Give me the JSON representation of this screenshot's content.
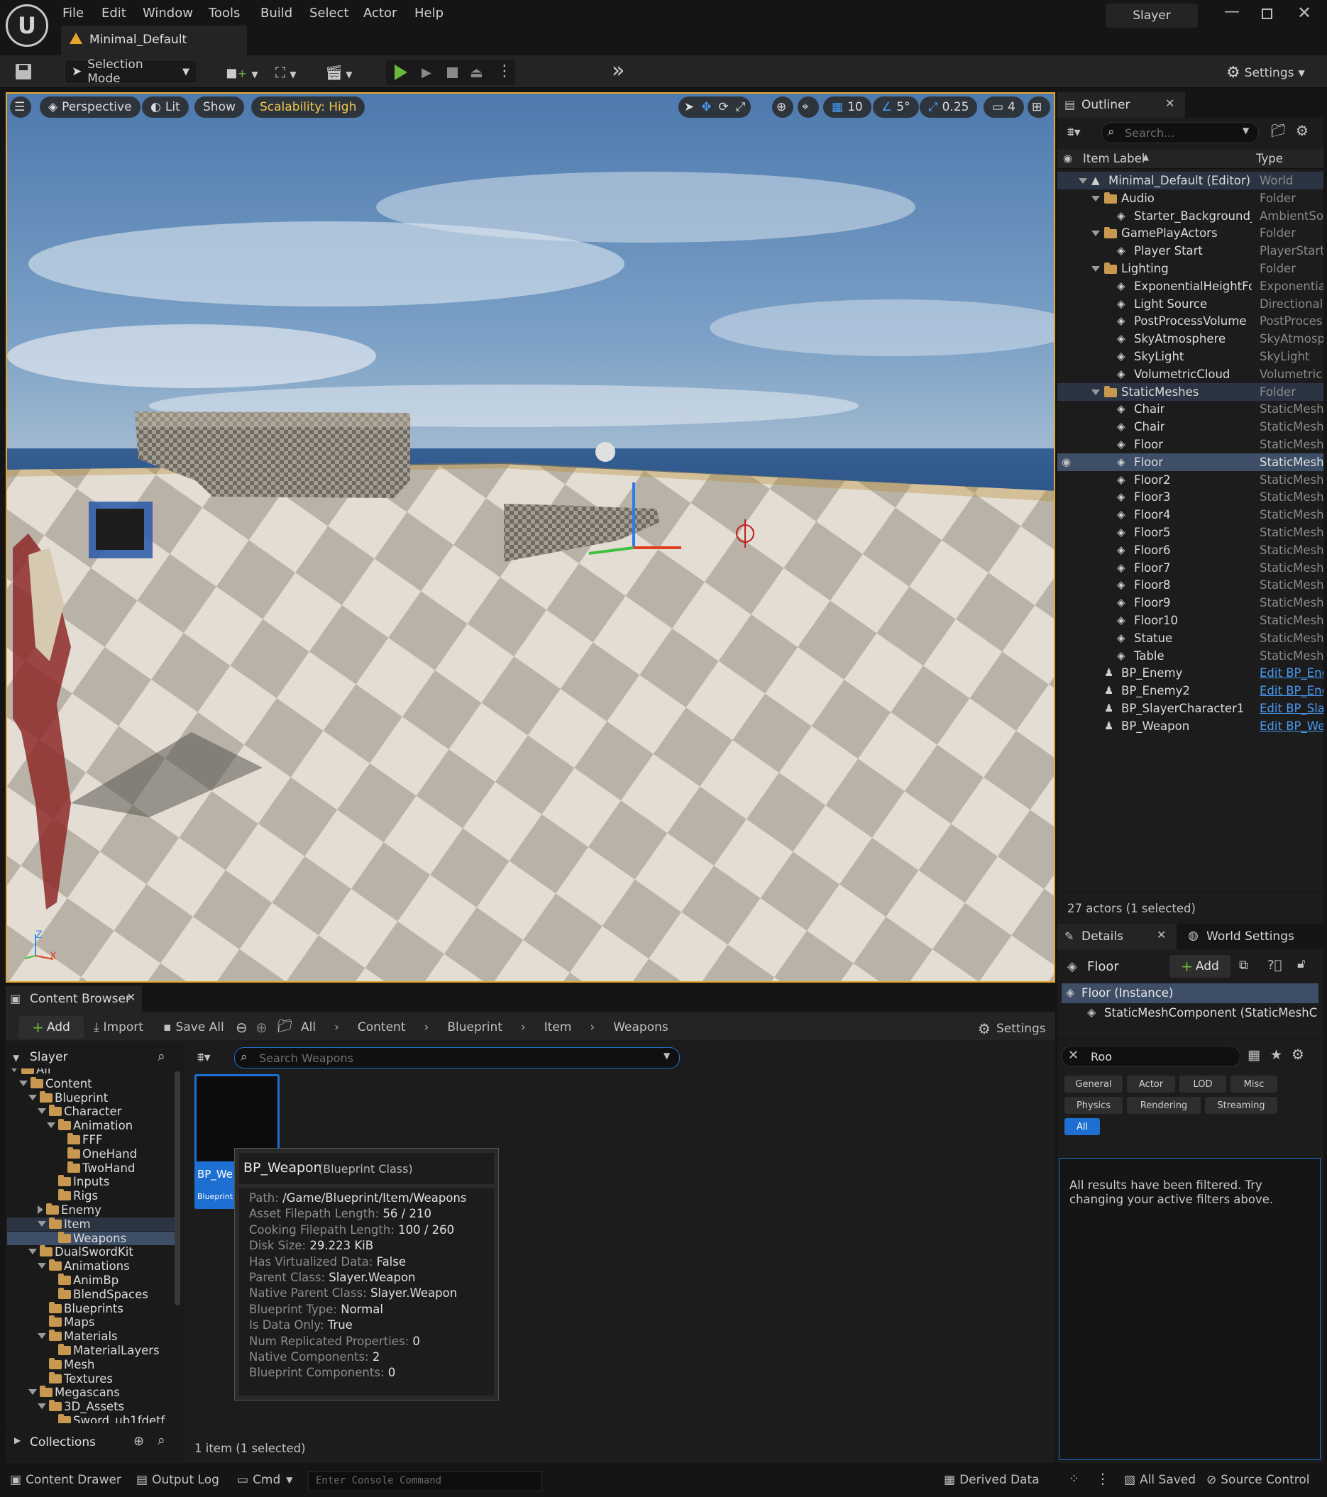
{
  "app": {
    "project": "Slayer",
    "level_tab": "Minimal_Default"
  },
  "menu": [
    "File",
    "Edit",
    "Window",
    "Tools",
    "Build",
    "Select",
    "Actor",
    "Help"
  ],
  "toolbar": {
    "selection_mode": "Selection Mode",
    "settings": "Settings"
  },
  "viewport": {
    "perspective": "Perspective",
    "lit": "Lit",
    "show": "Show",
    "scalability": "Scalability: High",
    "grid_snap": "10",
    "rot_snap": "5°",
    "scale_snap": "0.25",
    "cam_speed": "4",
    "axis": {
      "z": "Z",
      "x": "X",
      "y": "Y"
    }
  },
  "outliner": {
    "tab": "Outliner",
    "search_placeholder": "Search...",
    "col_label": "Item Label",
    "col_type": "Type",
    "rows": [
      {
        "label": "Minimal_Default (Editor)",
        "type": "World"
      },
      {
        "label": "Audio",
        "type": "Folder"
      },
      {
        "label": "Starter_Background_",
        "type": "AmbientSou"
      },
      {
        "label": "GamePlayActors",
        "type": "Folder"
      },
      {
        "label": "Player Start",
        "type": "PlayerStart"
      },
      {
        "label": "Lighting",
        "type": "Folder"
      },
      {
        "label": "ExponentialHeightFo",
        "type": "Exponentia"
      },
      {
        "label": "Light Source",
        "type": "Directionall"
      },
      {
        "label": "PostProcessVolume",
        "type": "PostProces"
      },
      {
        "label": "SkyAtmosphere",
        "type": "SkyAtmosp"
      },
      {
        "label": "SkyLight",
        "type": "SkyLight"
      },
      {
        "label": "VolumetricCloud",
        "type": "Volumetric"
      },
      {
        "label": "StaticMeshes",
        "type": "Folder"
      },
      {
        "label": "Chair",
        "type": "StaticMesh"
      },
      {
        "label": "Chair",
        "type": "StaticMesh"
      },
      {
        "label": "Floor",
        "type": "StaticMesh"
      },
      {
        "label": "Floor",
        "type": "StaticMesh"
      },
      {
        "label": "Floor2",
        "type": "StaticMesh"
      },
      {
        "label": "Floor3",
        "type": "StaticMesh"
      },
      {
        "label": "Floor4",
        "type": "StaticMesh"
      },
      {
        "label": "Floor5",
        "type": "StaticMesh"
      },
      {
        "label": "Floor6",
        "type": "StaticMesh"
      },
      {
        "label": "Floor7",
        "type": "StaticMesh"
      },
      {
        "label": "Floor8",
        "type": "StaticMesh"
      },
      {
        "label": "Floor9",
        "type": "StaticMesh"
      },
      {
        "label": "Floor10",
        "type": "StaticMesh"
      },
      {
        "label": "Statue",
        "type": "StaticMesh"
      },
      {
        "label": "Table",
        "type": "StaticMesh"
      },
      {
        "label": "BP_Enemy",
        "type": "Edit BP_Ene"
      },
      {
        "label": "BP_Enemy2",
        "type": "Edit BP_Ene"
      },
      {
        "label": "BP_SlayerCharacter1",
        "type": "Edit BP_Sla"
      },
      {
        "label": "BP_Weapon",
        "type": "Edit BP_We"
      }
    ],
    "status": "27 actors (1 selected)"
  },
  "details": {
    "tab": "Details",
    "tab2": "World Settings",
    "object": "Floor",
    "add": "Add",
    "instance": "Floor (Instance)",
    "component": "StaticMeshComponent (StaticMeshC",
    "search_value": "Roo",
    "filters": [
      "General",
      "Actor",
      "LOD",
      "Misc",
      "Physics",
      "Rendering",
      "Streaming",
      "All"
    ],
    "message": "All results have been filtered. Try changing your active filters above."
  },
  "content_browser": {
    "tab": "Content Browser",
    "add": "Add",
    "import": "Import",
    "save_all": "Save All",
    "breadcrumb": [
      "All",
      "Content",
      "Blueprint",
      "Item",
      "Weapons"
    ],
    "settings": "Settings",
    "root": "Slayer",
    "search_placeholder": "Search Weapons",
    "tree": [
      "All",
      "Content",
      "Blueprint",
      "Character",
      "Animation",
      "FFF",
      "OneHand",
      "TwoHand",
      "Inputs",
      "Rigs",
      "Enemy",
      "Item",
      "Weapons",
      "DualSwordKit",
      "Animations",
      "AnimBp",
      "BlendSpaces",
      "Blueprints",
      "Maps",
      "Materials",
      "MaterialLayers",
      "Mesh",
      "Textures",
      "Megascans",
      "3D_Assets",
      "Sword_ub1fdetf"
    ],
    "collections": "Collections",
    "asset_name": "BP_Weapon",
    "asset_name_short": "BP_We",
    "asset_type_short": "Blueprint",
    "status": "1 item (1 selected)"
  },
  "tooltip": {
    "title": "BP_Weapon",
    "subtitle": "(Blueprint Class)",
    "rows": [
      {
        "k": "Path:",
        "v": "/Game/Blueprint/Item/Weapons"
      },
      {
        "k": "Asset Filepath Length:",
        "v": "56 / 210"
      },
      {
        "k": "Cooking Filepath Length:",
        "v": "100 / 260"
      },
      {
        "k": "Disk Size:",
        "v": "29.223 KiB"
      },
      {
        "k": "Has Virtualized Data:",
        "v": "False"
      },
      {
        "k": "Parent Class:",
        "v": "Slayer.Weapon"
      },
      {
        "k": "Native Parent Class:",
        "v": "Slayer.Weapon"
      },
      {
        "k": "Blueprint Type:",
        "v": "Normal"
      },
      {
        "k": "Is Data Only:",
        "v": "True"
      },
      {
        "k": "Num Replicated Properties:",
        "v": "0"
      },
      {
        "k": "Native Components:",
        "v": "2"
      },
      {
        "k": "Blueprint Components:",
        "v": "0"
      }
    ]
  },
  "statusbar": {
    "content_drawer": "Content Drawer",
    "output_log": "Output Log",
    "cmd": "Cmd",
    "console_placeholder": "Enter Console Command",
    "derived_data": "Derived Data",
    "all_saved": "All Saved",
    "source_control": "Source Control"
  },
  "colors": {
    "accent": "#e6a62a",
    "selection": "#3d4e66",
    "link": "#4b9bf5",
    "play": "#6ab83c"
  }
}
